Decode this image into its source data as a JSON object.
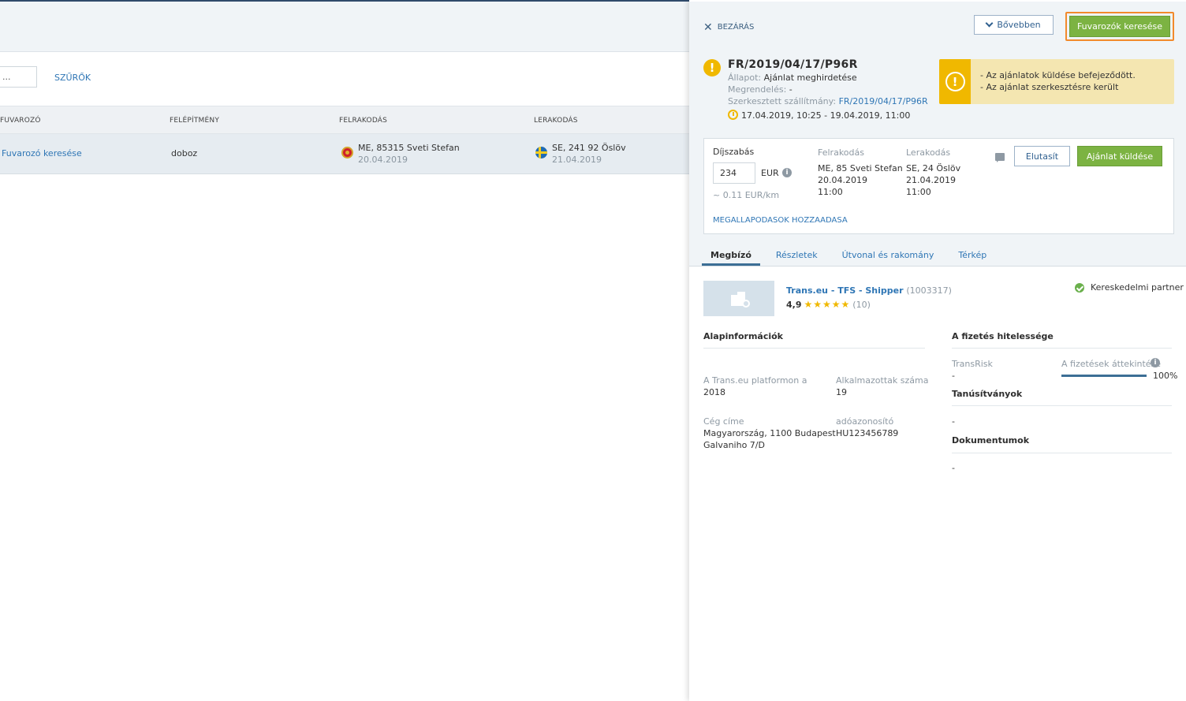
{
  "list": {
    "search_value": "...",
    "filters_label": "SZŰRŐK",
    "columns": [
      "FUVAROZÓ",
      "FELÉPÍTMÉNY",
      "FELRAKODÁS",
      "LERAKODÁS"
    ],
    "row": {
      "carrier": "Fuvarozó keresése",
      "body": "doboz",
      "loading_city": "ME, 85315 Sveti Stefan",
      "loading_date": "20.04.2019",
      "unloading_city": "SE, 241 92 Öslöv",
      "unloading_date": "21.04.2019"
    }
  },
  "panel": {
    "close_label": "BEZÁRÁS",
    "more_label": "Bővebben",
    "find_carriers_label": "Fuvarozók keresése",
    "shipment_id": "FR/2019/04/17/P96R",
    "status_label": "Állapot:",
    "status_value": "Ajánlat meghirdetése",
    "order_label": "Megrendelés:",
    "order_value": "-",
    "edited_label": "Szerkesztett szállítmány:",
    "edited_value": "FR/2019/04/17/P96R",
    "time_range": "17.04.2019, 10:25 - 19.04.2019, 11:00",
    "alerts": [
      "- Az ajánlatok küldése befejeződött.",
      "- Az ajánlat szerkesztésre került"
    ],
    "offer": {
      "price_label": "Díjszabás",
      "price_value": "234",
      "currency": "EUR",
      "per_km": "~ 0.11 EUR/km",
      "loading_label": "Felrakodás",
      "loading_place": "ME, 85 Sveti Stefan",
      "loading_date": "20.04.2019",
      "loading_time": "11:00",
      "unloading_label": "Lerakodás",
      "unloading_place": "SE, 24 Öslöv",
      "unloading_date": "21.04.2019",
      "unloading_time": "11:00",
      "add_terms": "MEGALLAPODASOK HOZZAADASA",
      "reject_label": "Elutasít",
      "send_label": "Ajánlat küldése"
    },
    "tabs": [
      "Megbízó",
      "Részletek",
      "Útvonal és rakomány",
      "Térkép"
    ],
    "company": {
      "name": "Trans.eu - TFS - Shipper",
      "id": "(1003317)",
      "rating": "4,9",
      "stars": "★★★★★",
      "reviews": "(10)",
      "partner_label": "Kereskedelmi partner"
    },
    "basic": {
      "title": "Alapinformációk",
      "platform_label": "A Trans.eu platformon a",
      "platform_value": "2018",
      "employees_label": "Alkalmazottak száma",
      "employees_value": "19",
      "address_label": "Cég címe",
      "address_line1": "Magyarország, 1100 Budapest",
      "address_line2": "Galvaniho 7/D",
      "tax_label": "adóazonosító",
      "tax_value": "HU123456789"
    },
    "payment": {
      "title": "A fizetés hitelessége",
      "transrisk_label": "TransRisk",
      "transrisk_value": "-",
      "overview_label": "A fizetések áttekintése",
      "overview_fraction": 1.0,
      "overview_pct": "100%",
      "certs_title": "Tanúsítványok",
      "certs_value": "-",
      "docs_title": "Dokumentumok",
      "docs_value": "-"
    }
  },
  "colors": {
    "accent_green": "#7cb342",
    "highlight_orange": "#f28a2c",
    "warning_yellow": "#f0b800",
    "link_blue": "#2f76b5"
  }
}
